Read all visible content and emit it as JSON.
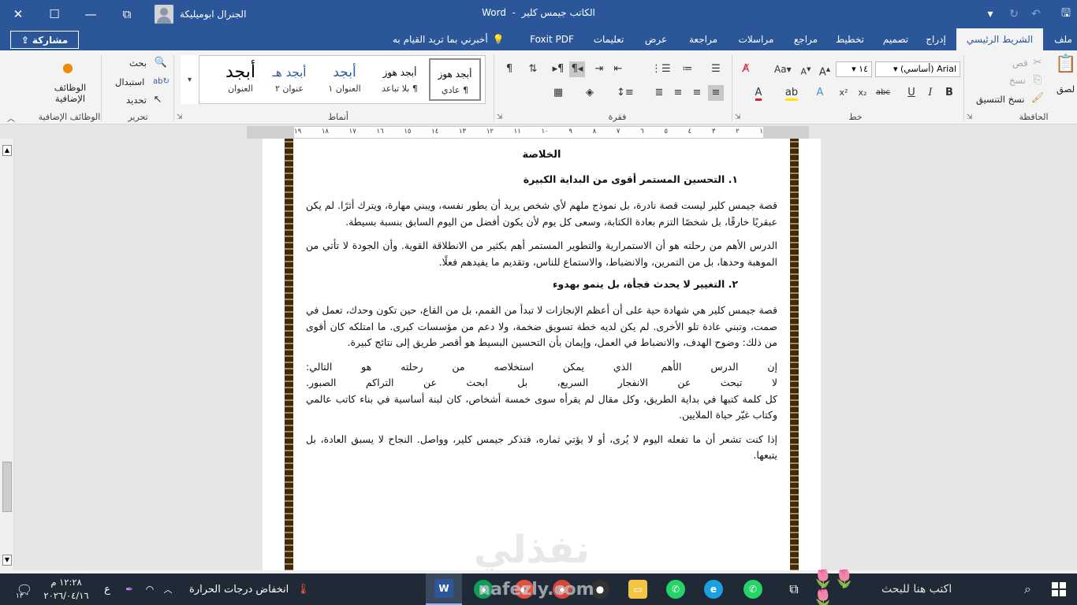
{
  "window": {
    "title": "الكاتب جيمس كلير",
    "app_name": "Word",
    "title_sep": "-",
    "user_name": "الجنرال ابوميليكة"
  },
  "quick_access": {
    "save_icon": "save-icon",
    "undo_icon": "undo-icon",
    "redo_icon": "redo-icon",
    "customize_icon": "chevron-down-icon"
  },
  "tabs": [
    {
      "label": "ملف"
    },
    {
      "label": "الشريط الرئيسي"
    },
    {
      "label": "إدراج"
    },
    {
      "label": "تصميم"
    },
    {
      "label": "تخطيط"
    },
    {
      "label": "مراجع"
    },
    {
      "label": "مراسلات"
    },
    {
      "label": "مراجعة"
    },
    {
      "label": "عرض"
    },
    {
      "label": "تعليمات"
    },
    {
      "label": "Foxit PDF"
    }
  ],
  "tell_me": "أخبرني بما تريد القيام به",
  "share_label": "مشاركة",
  "ribbon": {
    "clipboard": {
      "label": "الحافظة",
      "paste": "لصق",
      "cut": "قص",
      "copy": "نسخ",
      "format_painter": "نسخ التنسيق"
    },
    "font": {
      "label": "خط",
      "font_name": "Arial (أساسي)",
      "font_size": "١٤"
    },
    "paragraph": {
      "label": "فقرة"
    },
    "styles": {
      "label": "أنماط",
      "items": [
        {
          "preview": "أبجد هوز",
          "name": "¶ عادي"
        },
        {
          "preview": "أبجد هوز",
          "name": "¶ بلا تباعد"
        },
        {
          "preview": "أبجد",
          "name": "العنوان ١"
        },
        {
          "preview": "أبجد هـ",
          "name": "عنوان ٢"
        },
        {
          "preview": "أبجد هوز",
          "name": "العنوان"
        },
        {
          "preview": "أبجد",
          "name": "العنوان"
        }
      ]
    },
    "editing": {
      "label": "تحرير",
      "find": "بحث",
      "replace": "استبدال",
      "select": "تحديد"
    },
    "addins": {
      "label": "الوظائف الإضافية",
      "button": "الوظائف الإضافية"
    }
  },
  "ruler": {
    "ticks": [
      "١",
      "٢",
      "٣",
      "٤",
      "٥",
      "٦",
      "٧",
      "٨",
      "٩",
      "١٠",
      "١١",
      "١٢",
      "١٣",
      "١٤",
      "١٥",
      "١٦",
      "١٧",
      "١٨",
      "١٩"
    ]
  },
  "document": {
    "heading": "الخلاصة",
    "section1_title": "١.  التحسين المستمر أقوى من البداية الكبيرة",
    "p1": "قصة جيمس كلير ليست قصة نادرة، بل نموذج ملهم لأي شخص يريد أن يطور نفسه، ويبني مهارة، ويترك أثرًا. لم يكن عبقريًا خارقًا، بل شخصًا التزم بعادة الكتابة، وسعى كل يوم لأن يكون أفضل من اليوم السابق بنسبة بسيطة.",
    "p2": "الدرس الأهم من رحلته هو أن الاستمرارية والتطوير المستمر أهم بكثير من الانطلاقة القوية. وأن الجودة لا تأتي من الموهبة وحدها، بل من التمرين، والانضباط، والاستماع للناس، وتقديم ما يفيدهم فعلًا.",
    "section2_title": "٢.  التغيير لا يحدث فجأة، بل ينمو بهدوء",
    "p3": "قصة جيمس كلير هي شهادة حية على أن أعظم الإنجازات لا تبدأ من القمم، بل من القاع، حين تكون وحدك، تعمل في صمت، وتبني عادة تلو الأخرى. لم يكن لديه خطة تسويق ضخمة، ولا دعم من مؤسسات كبرى. ما امتلكه كان أقوى من ذلك: وضوح الهدف، والانضباط في العمل، وإيمان بأن التحسين البسيط هو أقصر طريق إلى نتائج كبيرة.",
    "p4a": "إن الدرس الأهم الذي يمكن استخلاصه من رحلته هو التالي:",
    "p4b": "لا تبحث عن الانفجار السريع، بل ابحث عن التراكم الصبور.",
    "p4c": "كل كلمة كتبها في بداية الطريق، وكل مقال لم يقرأه سوى خمسة أشخاص، كان لبنة أساسية في بناء كاتب عالمي وكتاب غيّر حياة الملايين.",
    "p5": "إذا كنت تشعر أن ما تفعله اليوم لا يُرى، أو لا يؤتي ثماره، فتذكر جيمس كلير، وواصل. النجاح لا يسبق العادة، بل يتبعها."
  },
  "watermark": "نفذلي",
  "taskbar": {
    "search_placeholder": "اكتب هنا للبحث",
    "weather_text": "انخفاض درجات الحرارة",
    "time": "١٢:٢٨ م",
    "date": "٢٠٢٦/٠٤/١٦",
    "lang": "ع",
    "notifications": "١٣",
    "taskbar_watermark": "nafezly.com"
  },
  "colors": {
    "word_blue": "#2b579a",
    "ribbon_bg": "#f3f3f3",
    "taskbar_bg": "#1f2a36"
  }
}
